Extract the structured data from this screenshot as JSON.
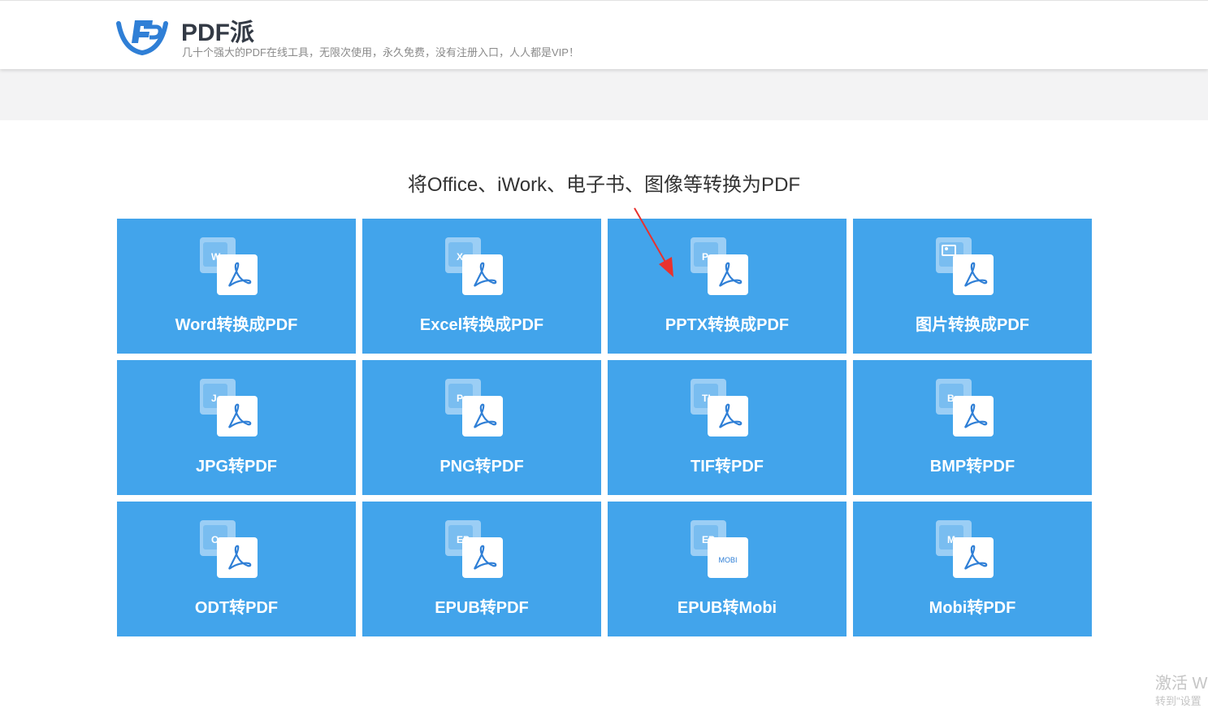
{
  "header": {
    "brand_name": "PDF派",
    "tagline": "几十个强大的PDF在线工具，无限次使用，永久免费，没有注册入口，人人都是VIP！",
    "logo_icon": "pdfpai-logo-icon"
  },
  "section": {
    "title": "将Office、iWork、电子书、图像等转换为PDF"
  },
  "colors": {
    "tile_bg": "#42a4eb",
    "tile_text": "#ffffff",
    "brand_blue": "#2f7fd6",
    "annotation_arrow": "#e8322e"
  },
  "tools": [
    {
      "label": "Word转换成PDF",
      "badge": "W",
      "icon": "word-to-pdf-icon"
    },
    {
      "label": "Excel转换成PDF",
      "badge": "X",
      "icon": "excel-to-pdf-icon"
    },
    {
      "label": "PPTX转换成PDF",
      "badge": "P",
      "icon": "pptx-to-pdf-icon"
    },
    {
      "label": "图片转换成PDF",
      "badge": "",
      "icon": "image-to-pdf-icon"
    },
    {
      "label": "JPG转PDF",
      "badge": "J",
      "icon": "jpg-to-pdf-icon"
    },
    {
      "label": "PNG转PDF",
      "badge": "P",
      "icon": "png-to-pdf-icon"
    },
    {
      "label": "TIF转PDF",
      "badge": "TI",
      "icon": "tif-to-pdf-icon"
    },
    {
      "label": "BMP转PDF",
      "badge": "B",
      "icon": "bmp-to-pdf-icon"
    },
    {
      "label": "ODT转PDF",
      "badge": "O",
      "icon": "odt-to-pdf-icon"
    },
    {
      "label": "EPUB转PDF",
      "badge": "EP",
      "icon": "epub-to-pdf-icon"
    },
    {
      "label": "EPUB转Mobi",
      "badge": "EP",
      "front_text": "MOBI",
      "icon": "epub-to-mobi-icon"
    },
    {
      "label": "Mobi转PDF",
      "badge": "M",
      "icon": "mobi-to-pdf-icon"
    }
  ],
  "watermark": {
    "line1": "激活 W",
    "line2": "转到\"设置"
  }
}
